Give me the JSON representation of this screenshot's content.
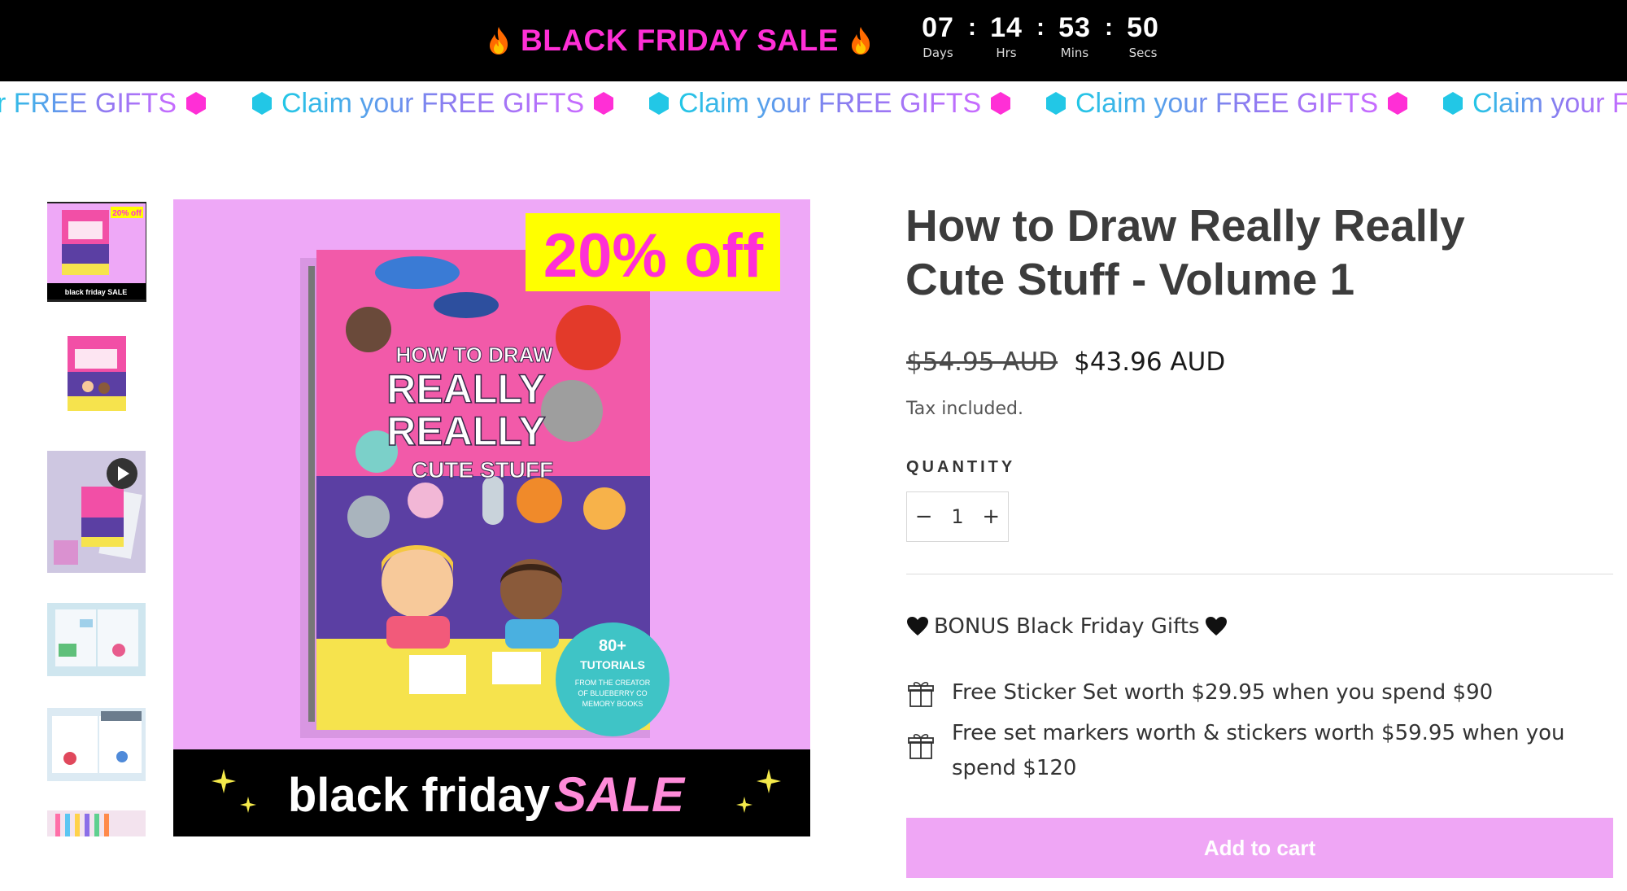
{
  "announcement": {
    "sale_text": "BLACK FRIDAY SALE",
    "countdown": [
      {
        "value": "07",
        "label": "Days"
      },
      {
        "value": "14",
        "label": "Hrs"
      },
      {
        "value": "53",
        "label": "Mins"
      },
      {
        "value": "50",
        "label": "Secs"
      }
    ],
    "separator": ":"
  },
  "marquee": {
    "text": "Claim your FREE GIFTS",
    "partial_left": "r FREE GIFTS",
    "partial_right": "Claim your F"
  },
  "hero": {
    "discount_badge": "20% off",
    "banner_left": "black friday",
    "banner_right": "SALE",
    "book_cover": {
      "line1": "HOW TO DRAW",
      "line2": "REALLY",
      "line3": "REALLY",
      "line4": "CUTE STUFF",
      "badge_count": "80+",
      "badge_title": "TUTORIALS",
      "badge_sub1": "FROM THE CREATOR",
      "badge_sub2": "OF BLUEBERRY CO",
      "badge_sub3": "MEMORY BOOKS"
    }
  },
  "thumbnails": {
    "thumb1_badge": "20% off",
    "thumb1_banner": "black friday SALE"
  },
  "product": {
    "title": "How to Draw Really Really Cute Stuff - Volume 1",
    "compare_price": "$54.95 AUD",
    "price": "$43.96 AUD",
    "tax_note": "Tax included.",
    "quantity_label": "QUANTITY",
    "quantity_value": "1",
    "minus": "−",
    "plus": "+",
    "bonus_heading": "BONUS Black Friday Gifts",
    "gifts": [
      "Free Sticker Set worth $29.95 when you spend $90",
      "Free set markers worth & stickers worth $59.95 when you spend $120"
    ],
    "add_to_cart": "Add to cart"
  },
  "colors": {
    "sale_pink": "#ff2fd6",
    "hero_bg": "#eea8f7",
    "badge_yellow": "#ffff00",
    "cart_button": "#efa6f5",
    "marquee_cyan": "#22c7e6",
    "marquee_magenta": "#ff2fd6"
  },
  "icons": [
    "fire-icon",
    "hexagon-badge-icon",
    "play-icon",
    "heart-icon",
    "gift-icon",
    "sparkle-icon"
  ]
}
